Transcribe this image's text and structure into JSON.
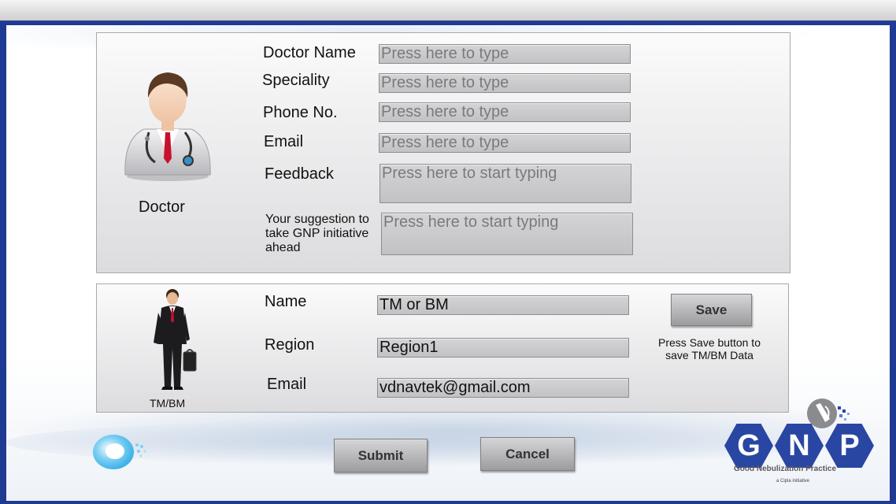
{
  "doctor_section": {
    "avatar_caption": "Doctor",
    "fields": [
      {
        "label": "Doctor Name",
        "value": "",
        "placeholder": "Press here to type"
      },
      {
        "label": "Speciality",
        "value": "",
        "placeholder": "Press here to type"
      },
      {
        "label": "Phone No.",
        "value": "",
        "placeholder": "Press here to type"
      },
      {
        "label": "Email",
        "value": "",
        "placeholder": "Press here to type"
      },
      {
        "label": "Feedback",
        "value": "",
        "placeholder": "Press here to start typing"
      },
      {
        "label": "Your suggestion to take GNP initiative ahead",
        "value": "",
        "placeholder": "Press here to start typing"
      }
    ]
  },
  "tm_section": {
    "avatar_caption": "TM/BM",
    "fields": [
      {
        "label": "Name",
        "value": "TM or BM"
      },
      {
        "label": "Region",
        "value": "Region1"
      },
      {
        "label": "Email",
        "value": "vdnavtek@gmail.com"
      }
    ],
    "save_label": "Save",
    "save_note": "Press Save button to save TM/BM Data"
  },
  "actions": {
    "submit_label": "Submit",
    "cancel_label": "Cancel"
  },
  "logo": {
    "letters": [
      "G",
      "N",
      "P"
    ],
    "tagline": "Good Nebulization Practice",
    "subtag": "a Cipla initiative"
  },
  "colors": {
    "frame": "#1f3a92",
    "logo_blue": "#2a46a3"
  }
}
